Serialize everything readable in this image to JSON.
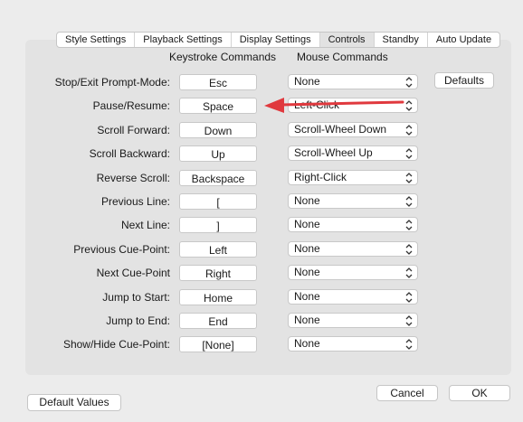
{
  "tabs": [
    "Style Settings",
    "Playback Settings",
    "Display Settings",
    "Controls",
    "Standby",
    "Auto Update"
  ],
  "active_tab": "Controls",
  "columns": {
    "keystroke": "Keystroke Commands",
    "mouse": "Mouse Commands"
  },
  "rows": [
    {
      "label": "Stop/Exit Prompt-Mode:",
      "key": "Esc",
      "mouse": "None"
    },
    {
      "label": "Pause/Resume:",
      "key": "Space",
      "mouse": "Left-Click"
    },
    {
      "label": "Scroll Forward:",
      "key": "Down",
      "mouse": "Scroll-Wheel Down"
    },
    {
      "label": "Scroll Backward:",
      "key": "Up",
      "mouse": "Scroll-Wheel Up"
    },
    {
      "label": "Reverse Scroll:",
      "key": "Backspace",
      "mouse": "Right-Click"
    },
    {
      "label": "Previous Line:",
      "key": "[",
      "mouse": "None"
    },
    {
      "label": "Next Line:",
      "key": "]",
      "mouse": "None"
    },
    {
      "label": "Previous Cue-Point:",
      "key": "Left",
      "mouse": "None"
    },
    {
      "label": "Next Cue-Point",
      "key": "Right",
      "mouse": "None"
    },
    {
      "label": "Jump to Start:",
      "key": "Home",
      "mouse": "None"
    },
    {
      "label": "Jump to End:",
      "key": "End",
      "mouse": "None"
    },
    {
      "label": "Show/Hide Cue-Point:",
      "key": "[None]",
      "mouse": "None"
    }
  ],
  "buttons": {
    "defaults": "Defaults",
    "default_values": "Default Values",
    "cancel": "Cancel",
    "ok": "OK"
  },
  "annotation": {
    "type": "arrow",
    "color": "#e0393e",
    "points_to": "Pause/Resume key field"
  },
  "icons": {
    "select": "chevron-up-down-icon"
  },
  "colors": {
    "window": "#ececec",
    "panel": "#e3e3e3",
    "control": "#ffffff",
    "arrow": "#e0393e"
  }
}
